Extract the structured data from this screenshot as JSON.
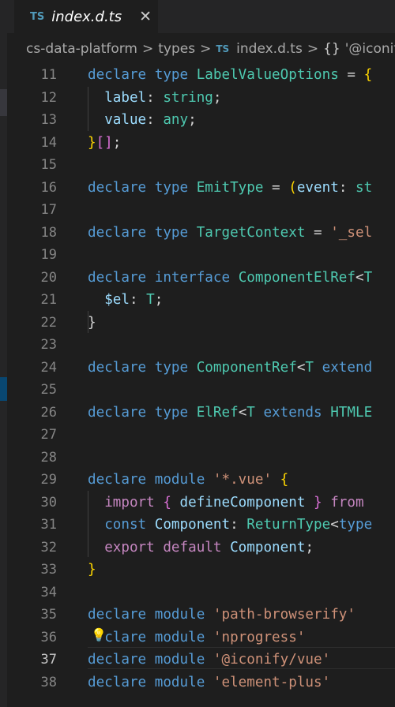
{
  "tab": {
    "badge": "TS",
    "title": "index.d.ts",
    "close": "✕"
  },
  "breadcrumb": {
    "items": [
      "cs-data-platform",
      "types",
      "index.d.ts",
      "'@iconify/vue'"
    ],
    "separator": ">",
    "file_badge": "TS",
    "symbol_glyph": "{}"
  },
  "editor": {
    "active_line": "37",
    "lightbulb": "💡",
    "lines": [
      {
        "n": "11",
        "tokens": [
          [
            "kw",
            "declare"
          ],
          [
            "pn",
            " "
          ],
          [
            "kw",
            "type"
          ],
          [
            "pn",
            " "
          ],
          [
            "ty",
            "LabelValueOptions"
          ],
          [
            "pn",
            " = "
          ],
          [
            "br1",
            "{"
          ]
        ]
      },
      {
        "n": "12",
        "tokens": [
          [
            "pn",
            "  "
          ],
          [
            "vr",
            "label"
          ],
          [
            "pn",
            ": "
          ],
          [
            "ty",
            "string"
          ],
          [
            "pn",
            ";"
          ]
        ]
      },
      {
        "n": "13",
        "tokens": [
          [
            "pn",
            "  "
          ],
          [
            "vr",
            "value"
          ],
          [
            "pn",
            ": "
          ],
          [
            "ty",
            "any"
          ],
          [
            "pn",
            ";"
          ]
        ]
      },
      {
        "n": "14",
        "tokens": [
          [
            "br1",
            "}"
          ],
          [
            "br2",
            "[]"
          ],
          [
            "pn",
            ";"
          ]
        ]
      },
      {
        "n": "15",
        "tokens": []
      },
      {
        "n": "16",
        "tokens": [
          [
            "kw",
            "declare"
          ],
          [
            "pn",
            " "
          ],
          [
            "kw",
            "type"
          ],
          [
            "pn",
            " "
          ],
          [
            "ty",
            "EmitType"
          ],
          [
            "pn",
            " = "
          ],
          [
            "br1",
            "("
          ],
          [
            "vr",
            "event"
          ],
          [
            "pn",
            ": "
          ],
          [
            "ty",
            "st"
          ]
        ]
      },
      {
        "n": "17",
        "tokens": []
      },
      {
        "n": "18",
        "tokens": [
          [
            "kw",
            "declare"
          ],
          [
            "pn",
            " "
          ],
          [
            "kw",
            "type"
          ],
          [
            "pn",
            " "
          ],
          [
            "ty",
            "TargetContext"
          ],
          [
            "pn",
            " = "
          ],
          [
            "str",
            "'_sel"
          ]
        ]
      },
      {
        "n": "19",
        "tokens": []
      },
      {
        "n": "20",
        "tokens": [
          [
            "kw",
            "declare"
          ],
          [
            "pn",
            " "
          ],
          [
            "kw",
            "interface"
          ],
          [
            "pn",
            " "
          ],
          [
            "ty",
            "ComponentElRef"
          ],
          [
            "pn",
            "<"
          ],
          [
            "ty",
            "T"
          ]
        ]
      },
      {
        "n": "21",
        "tokens": [
          [
            "pn",
            "  "
          ],
          [
            "vr",
            "$el"
          ],
          [
            "pn",
            ": "
          ],
          [
            "ty",
            "T"
          ],
          [
            "pn",
            ";"
          ]
        ]
      },
      {
        "n": "22",
        "tokens": [
          [
            "pn",
            "}"
          ]
        ]
      },
      {
        "n": "23",
        "tokens": []
      },
      {
        "n": "24",
        "tokens": [
          [
            "kw",
            "declare"
          ],
          [
            "pn",
            " "
          ],
          [
            "kw",
            "type"
          ],
          [
            "pn",
            " "
          ],
          [
            "ty",
            "ComponentRef"
          ],
          [
            "pn",
            "<"
          ],
          [
            "ty",
            "T"
          ],
          [
            "pn",
            " "
          ],
          [
            "kw",
            "extend"
          ]
        ]
      },
      {
        "n": "25",
        "tokens": []
      },
      {
        "n": "26",
        "tokens": [
          [
            "kw",
            "declare"
          ],
          [
            "pn",
            " "
          ],
          [
            "kw",
            "type"
          ],
          [
            "pn",
            " "
          ],
          [
            "ty",
            "ElRef"
          ],
          [
            "pn",
            "<"
          ],
          [
            "ty",
            "T"
          ],
          [
            "pn",
            " "
          ],
          [
            "kw",
            "extends"
          ],
          [
            "pn",
            " "
          ],
          [
            "ty",
            "HTMLE"
          ]
        ]
      },
      {
        "n": "27",
        "tokens": []
      },
      {
        "n": "28",
        "tokens": []
      },
      {
        "n": "29",
        "tokens": [
          [
            "kw",
            "declare"
          ],
          [
            "pn",
            " "
          ],
          [
            "kw",
            "module"
          ],
          [
            "pn",
            " "
          ],
          [
            "str",
            "'*.vue'"
          ],
          [
            "pn",
            " "
          ],
          [
            "br1",
            "{"
          ]
        ]
      },
      {
        "n": "30",
        "tokens": [
          [
            "pn",
            "  "
          ],
          [
            "ctl",
            "import"
          ],
          [
            "pn",
            " "
          ],
          [
            "br2",
            "{"
          ],
          [
            "pn",
            " "
          ],
          [
            "vr",
            "defineComponent"
          ],
          [
            "pn",
            " "
          ],
          [
            "br2",
            "}"
          ],
          [
            "pn",
            " "
          ],
          [
            "ctl",
            "from"
          ]
        ]
      },
      {
        "n": "31",
        "tokens": [
          [
            "pn",
            "  "
          ],
          [
            "kw",
            "const"
          ],
          [
            "pn",
            " "
          ],
          [
            "vr",
            "Component"
          ],
          [
            "pn",
            ": "
          ],
          [
            "ty",
            "ReturnType"
          ],
          [
            "pn",
            "<"
          ],
          [
            "kw",
            "type"
          ]
        ]
      },
      {
        "n": "32",
        "tokens": [
          [
            "pn",
            "  "
          ],
          [
            "ctl",
            "export"
          ],
          [
            "pn",
            " "
          ],
          [
            "ctl",
            "default"
          ],
          [
            "pn",
            " "
          ],
          [
            "vr",
            "Component"
          ],
          [
            "pn",
            ";"
          ]
        ]
      },
      {
        "n": "33",
        "tokens": [
          [
            "br1",
            "}"
          ]
        ]
      },
      {
        "n": "34",
        "tokens": []
      },
      {
        "n": "35",
        "tokens": [
          [
            "kw",
            "declare"
          ],
          [
            "pn",
            " "
          ],
          [
            "kw",
            "module"
          ],
          [
            "pn",
            " "
          ],
          [
            "str",
            "'path-browserify'"
          ]
        ]
      },
      {
        "n": "36",
        "tokens": [
          [
            "pn",
            "  "
          ],
          [
            "kw",
            "clare"
          ],
          [
            "pn",
            " "
          ],
          [
            "kw",
            "module"
          ],
          [
            "pn",
            " "
          ],
          [
            "str",
            "'nprogress'"
          ]
        ]
      },
      {
        "n": "37",
        "tokens": [
          [
            "kw",
            "declare"
          ],
          [
            "pn",
            " "
          ],
          [
            "kw",
            "module"
          ],
          [
            "pn",
            " "
          ],
          [
            "str",
            "'@iconify/vue'"
          ]
        ]
      },
      {
        "n": "38",
        "tokens": [
          [
            "kw",
            "declare"
          ],
          [
            "pn",
            " "
          ],
          [
            "kw",
            "module"
          ],
          [
            "pn",
            " "
          ],
          [
            "str",
            "'element-plus'"
          ]
        ]
      }
    ]
  }
}
